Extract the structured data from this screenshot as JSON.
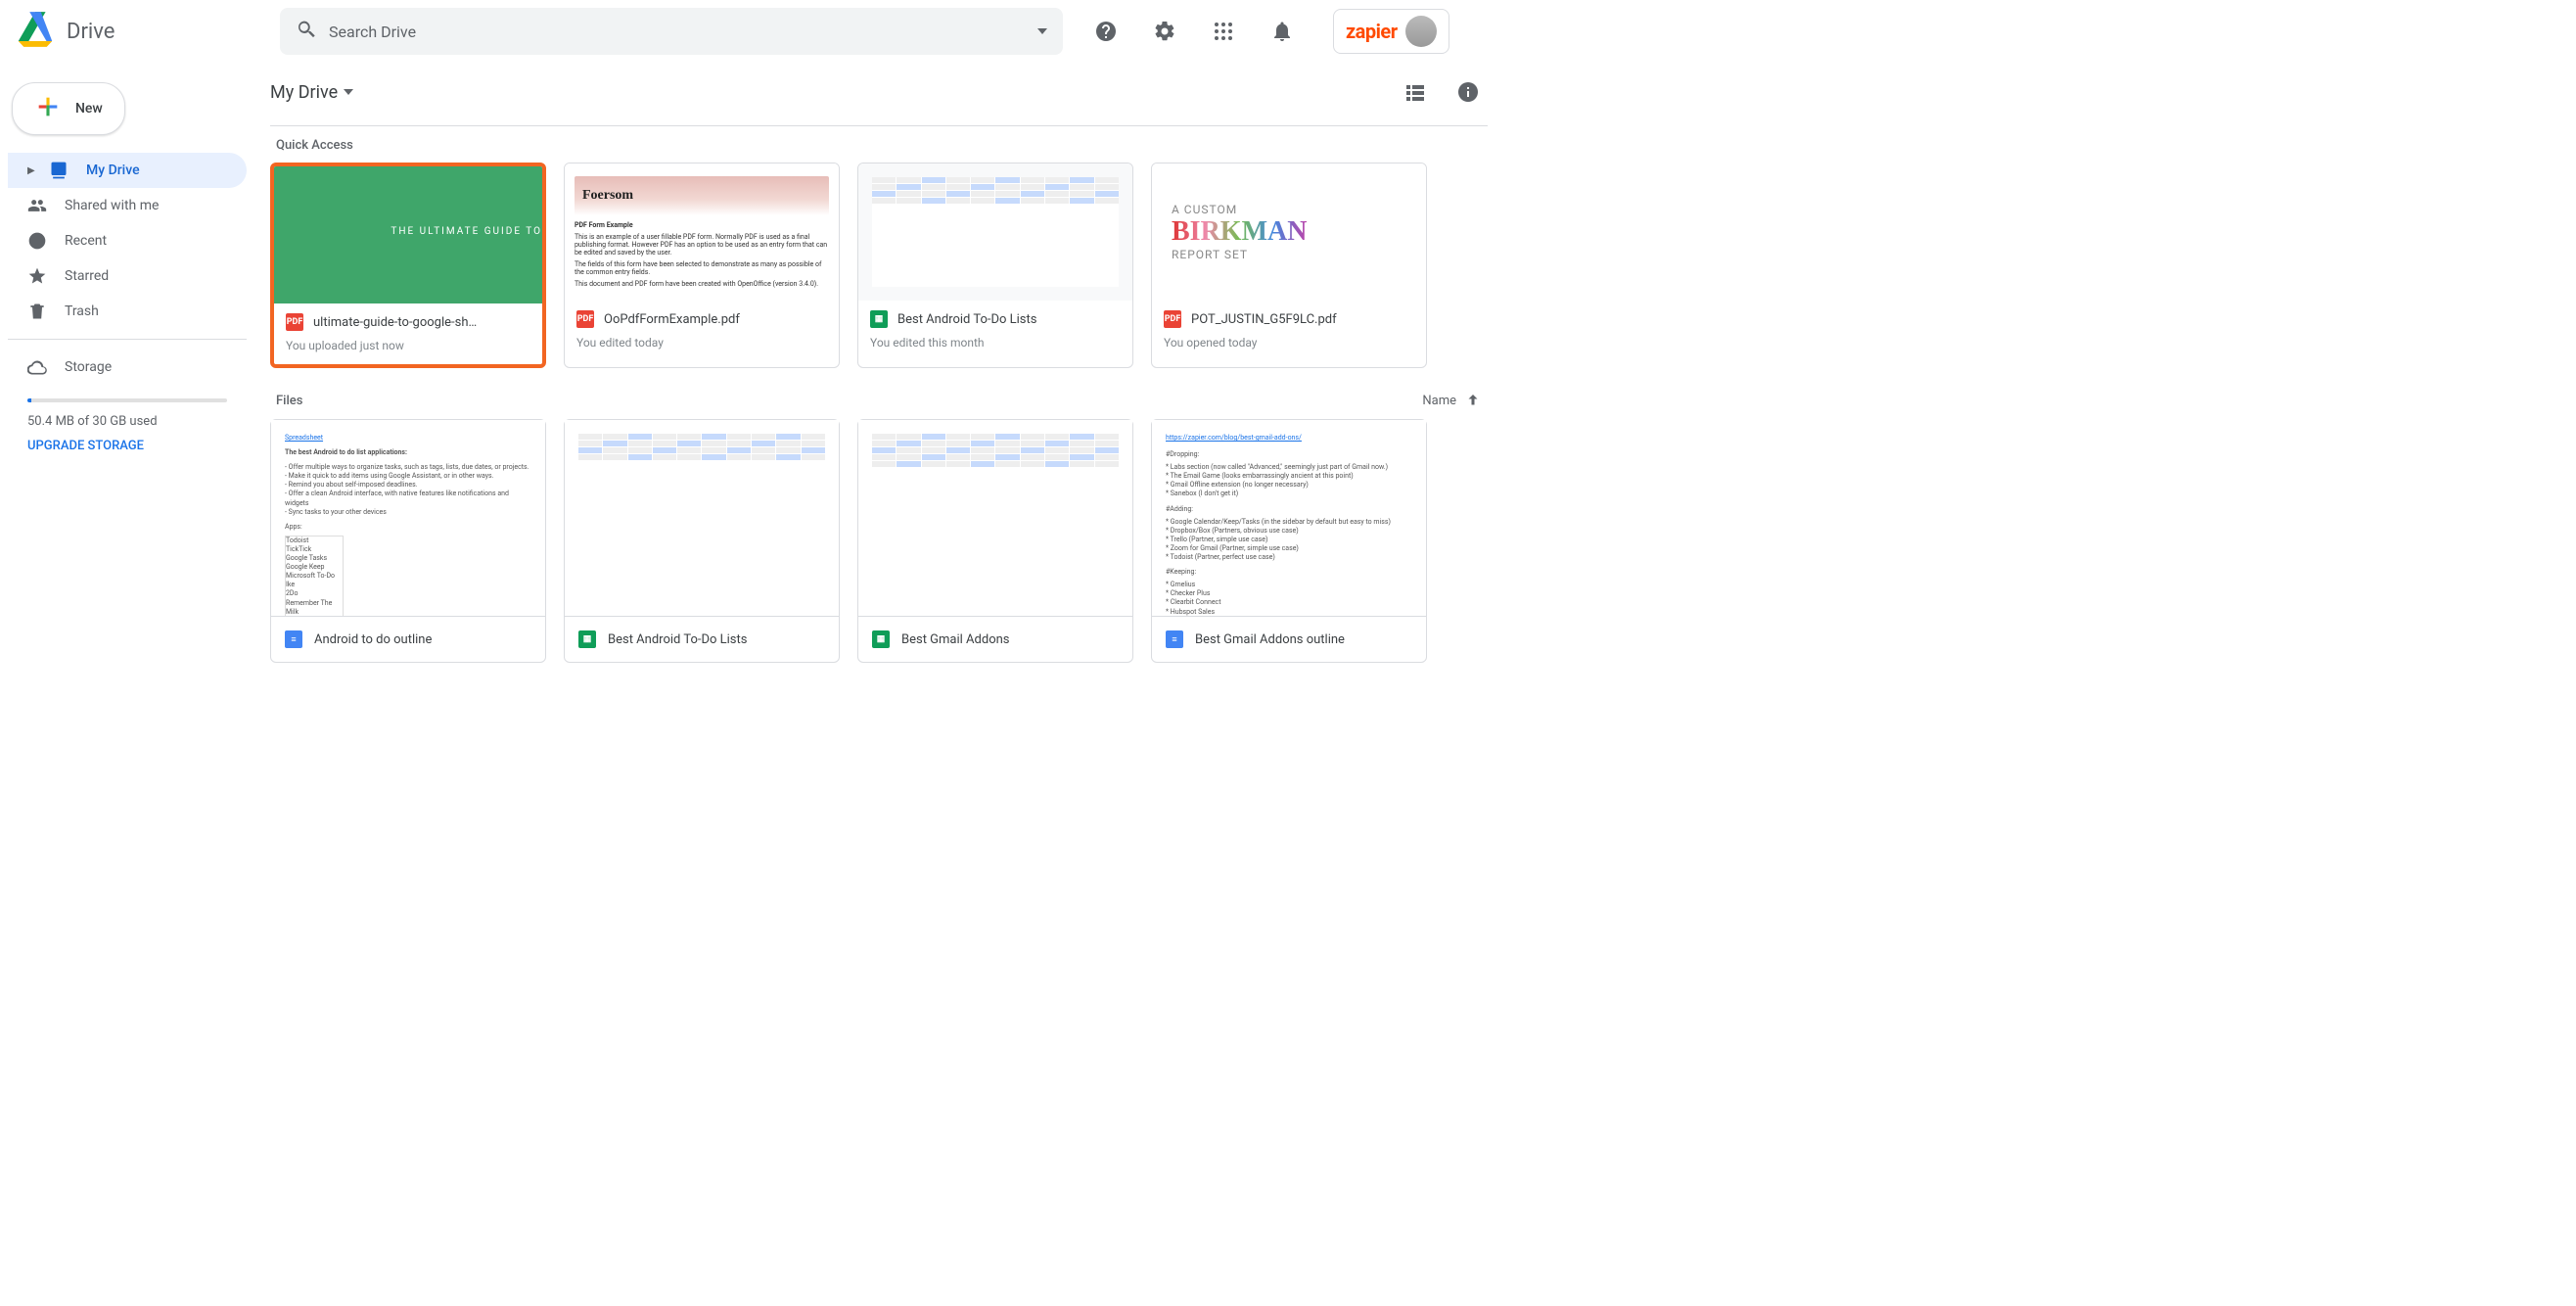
{
  "app": {
    "name": "Drive"
  },
  "search": {
    "placeholder": "Search Drive"
  },
  "sidebar": {
    "new_label": "New",
    "items": [
      {
        "label": "My Drive",
        "active": true
      },
      {
        "label": "Shared with me"
      },
      {
        "label": "Recent"
      },
      {
        "label": "Starred"
      },
      {
        "label": "Trash"
      }
    ],
    "storage_label": "Storage",
    "storage_used": "50.4 MB of 30 GB used",
    "upgrade_label": "UPGRADE STORAGE"
  },
  "header_icons": {
    "help": "help-icon",
    "settings": "gear-icon",
    "apps": "apps-grid-icon",
    "notifications": "bell-icon"
  },
  "account": {
    "brand": "zapier"
  },
  "breadcrumb": {
    "root": "My Drive"
  },
  "view": {
    "list_icon": "list-view-icon",
    "info_icon": "info-icon"
  },
  "quick_access": {
    "title": "Quick Access",
    "items": [
      {
        "title": "ultimate-guide-to-google-sh…",
        "subtitle": "You uploaded just now",
        "type": "pdf",
        "thumb_text": "THE ULTIMATE GUIDE TO",
        "highlight": true
      },
      {
        "title": "OoPdfFormExample.pdf",
        "subtitle": "You edited today",
        "type": "pdf",
        "thumb_heading": "Foersom",
        "thumb_subhead": "PDF Form Example",
        "thumb_body1": "This is an example of a user fillable PDF form. Normally PDF is used as a final publishing format. However PDF has an option to be used as an entry form that can be edited and saved by the user.",
        "thumb_body2": "The fields of this form have been selected to demonstrate as many as possible of the common entry fields.",
        "thumb_body3": "This document and PDF form have been created with OpenOffice (version 3.4.0)."
      },
      {
        "title": "Best Android To-Do Lists",
        "subtitle": "You edited this month",
        "type": "sheet"
      },
      {
        "title": "POT_JUSTIN_G5F9LC.pdf",
        "subtitle": "You opened today",
        "type": "pdf",
        "birkman_a": "A CUSTOM",
        "birkman_b": "BIRKMAN",
        "birkman_c": "REPORT SET"
      }
    ]
  },
  "files": {
    "title": "Files",
    "sort_label": "Name",
    "items": [
      {
        "title": "Android to do outline",
        "type": "doc"
      },
      {
        "title": "Best Android To-Do Lists",
        "type": "sheet"
      },
      {
        "title": "Best Gmail Addons",
        "type": "sheet"
      },
      {
        "title": "Best Gmail Addons outline",
        "type": "doc"
      }
    ]
  }
}
